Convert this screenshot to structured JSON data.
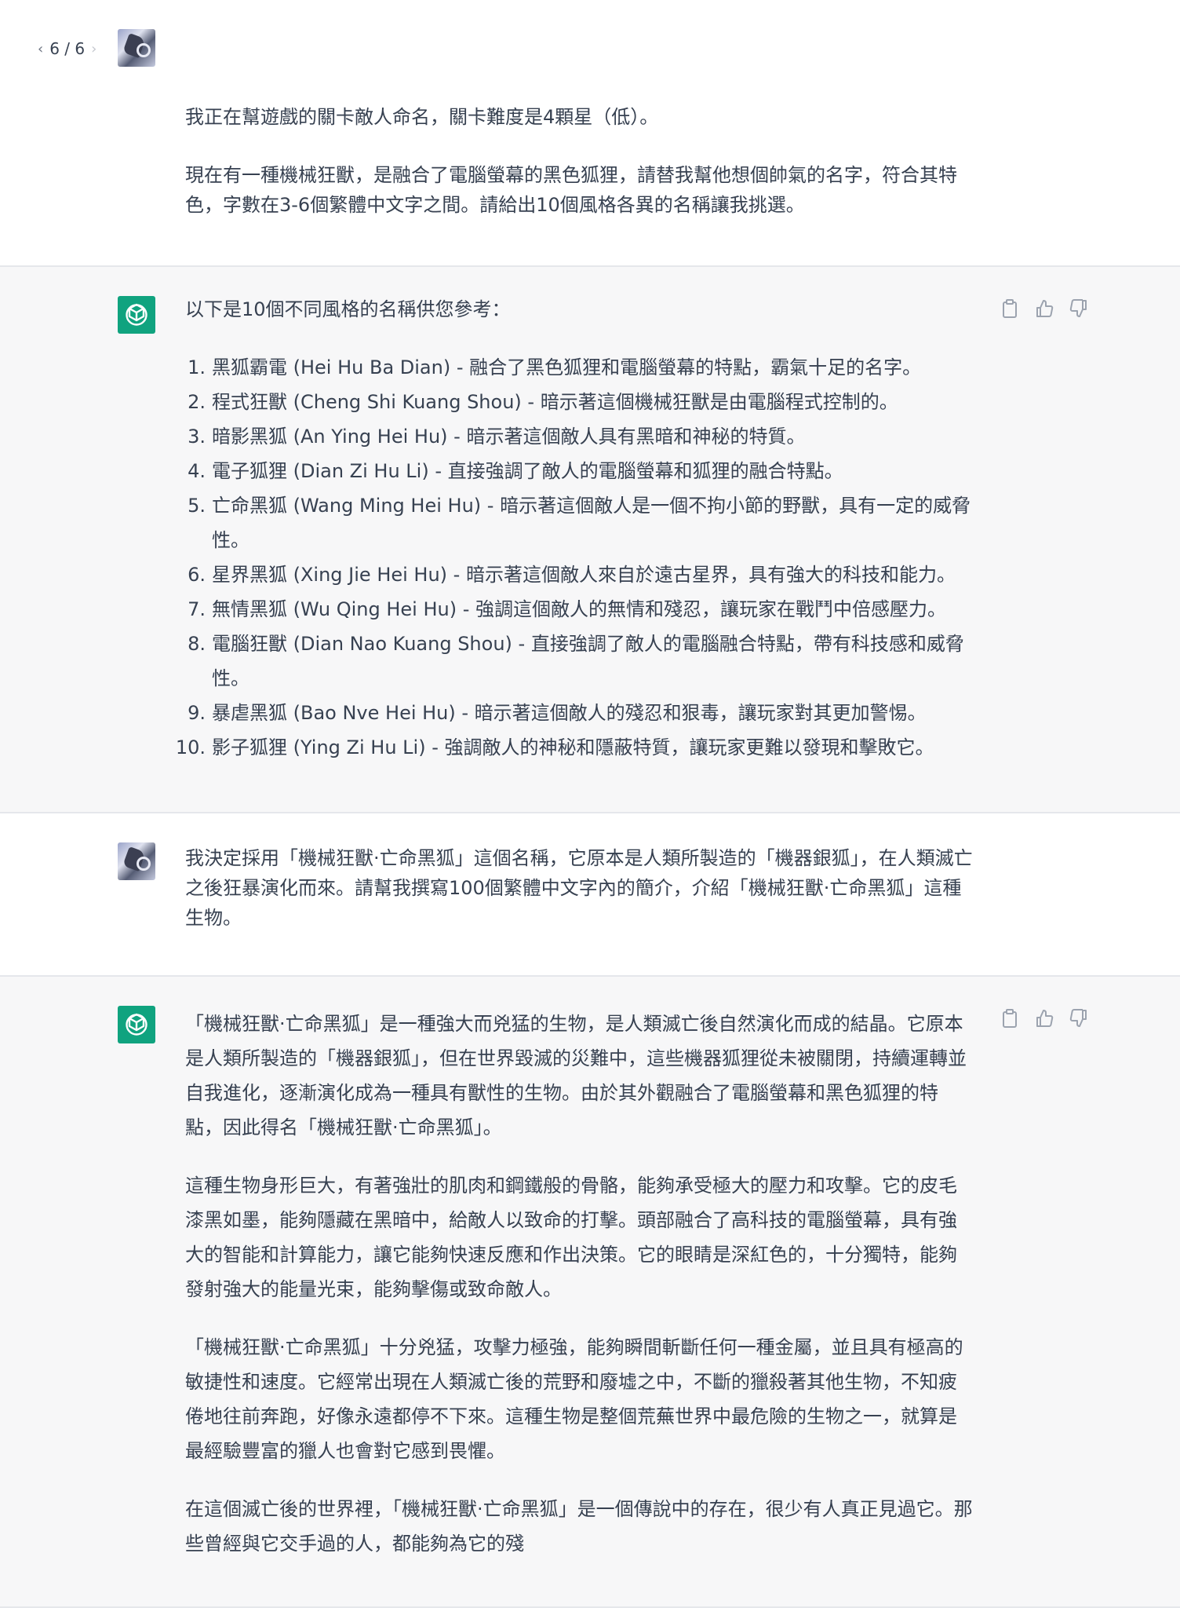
{
  "pager": {
    "label": "6 / 6",
    "prev": "‹",
    "next": "›"
  },
  "messages": {
    "user1": {
      "paragraphs": [
        "我正在幫遊戲的關卡敵人命名，關卡難度是4顆星（低）。",
        "現在有一種機械狂獸，是融合了電腦螢幕的黑色狐狸，請替我幫他想個帥氣的名字，符合其特色，字數在3-6個繁體中文字之間。請給出10個風格各異的名稱讓我挑選。"
      ]
    },
    "bot1": {
      "intro": "以下是10個不同風格的名稱供您參考：",
      "items": [
        {
          "num": "1.",
          "text": "黑狐霸電 (Hei Hu Ba Dian) - 融合了黑色狐狸和電腦螢幕的特點，霸氣十足的名字。"
        },
        {
          "num": "2.",
          "text": "程式狂獸 (Cheng Shi Kuang Shou) - 暗示著這個機械狂獸是由電腦程式控制的。"
        },
        {
          "num": "3.",
          "text": "暗影黑狐 (An Ying Hei Hu) - 暗示著這個敵人具有黑暗和神秘的特質。"
        },
        {
          "num": "4.",
          "text": "電子狐狸 (Dian Zi Hu Li) - 直接強調了敵人的電腦螢幕和狐狸的融合特點。"
        },
        {
          "num": "5.",
          "text": "亡命黑狐 (Wang Ming Hei Hu) - 暗示著這個敵人是一個不拘小節的野獸，具有一定的威脅性。"
        },
        {
          "num": "6.",
          "text": "星界黑狐 (Xing Jie Hei Hu) - 暗示著這個敵人來自於遠古星界，具有強大的科技和能力。"
        },
        {
          "num": "7.",
          "text": "無情黑狐 (Wu Qing Hei Hu) - 強調這個敵人的無情和殘忍，讓玩家在戰鬥中倍感壓力。"
        },
        {
          "num": "8.",
          "text": "電腦狂獸 (Dian Nao Kuang Shou) - 直接強調了敵人的電腦融合特點，帶有科技感和威脅性。"
        },
        {
          "num": "9.",
          "text": "暴虐黑狐 (Bao Nve Hei Hu) - 暗示著這個敵人的殘忍和狠毒，讓玩家對其更加警惕。"
        },
        {
          "num": "10.",
          "text": "影子狐狸 (Ying Zi Hu Li) - 強調敵人的神秘和隱蔽特質，讓玩家更難以發現和擊敗它。"
        }
      ]
    },
    "user2": {
      "text": "我決定採用「機械狂獸·亡命黑狐」這個名稱，它原本是人類所製造的「機器銀狐」，在人類滅亡之後狂暴演化而來。請幫我撰寫100個繁體中文字內的簡介，介紹「機械狂獸·亡命黑狐」這種生物。"
    },
    "bot2": {
      "paragraphs": [
        "「機械狂獸·亡命黑狐」是一種強大而兇猛的生物，是人類滅亡後自然演化而成的結晶。它原本是人類所製造的「機器銀狐」，但在世界毀滅的災難中，這些機器狐狸從未被關閉，持續運轉並自我進化，逐漸演化成為一種具有獸性的生物。由於其外觀融合了電腦螢幕和黑色狐狸的特點，因此得名「機械狂獸·亡命黑狐」。",
        "這種生物身形巨大，有著強壯的肌肉和鋼鐵般的骨骼，能夠承受極大的壓力和攻擊。它的皮毛漆黑如墨，能夠隱藏在黑暗中，給敵人以致命的打擊。頭部融合了高科技的電腦螢幕，具有強大的智能和計算能力，讓它能夠快速反應和作出決策。它的眼睛是深紅色的，十分獨特，能夠發射強大的能量光束，能夠擊傷或致命敵人。",
        "「機械狂獸·亡命黑狐」十分兇猛，攻擊力極強，能夠瞬間斬斷任何一種金屬，並且具有極高的敏捷性和速度。它經常出現在人類滅亡後的荒野和廢墟之中，不斷的獵殺著其他生物，不知疲倦地往前奔跑，好像永遠都停不下來。這種生物是整個荒蕪世界中最危險的生物之一，就算是最經驗豐富的獵人也會對它感到畏懼。",
        "在這個滅亡後的世界裡，「機械狂獸·亡命黑狐」是一個傳說中的存在，很少有人真正見過它。那些曾經與它交手過的人，都能夠為它的殘"
      ]
    }
  },
  "icons": [
    "user-avatar-icon",
    "openai-logo-icon",
    "clipboard-icon",
    "thumbs-up-icon",
    "thumbs-down-icon"
  ],
  "colors": {
    "accent": "#10a37f",
    "bot_bg": "#f7f7f8",
    "text": "#374151",
    "icon": "#9ca3af"
  }
}
